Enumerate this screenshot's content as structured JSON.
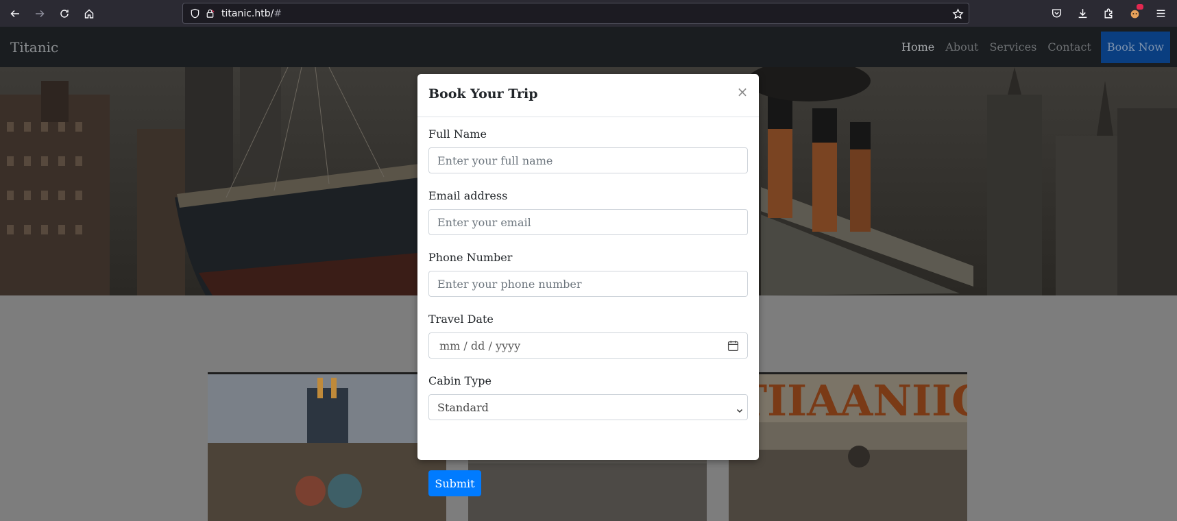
{
  "browser": {
    "url_host": "titanic.htb/",
    "url_suffix": "#",
    "icons": [
      "back-icon",
      "forward-icon",
      "reload-icon",
      "home-icon",
      "shield-icon",
      "lock-icon",
      "bookmark-star-icon",
      "pocket-icon",
      "download-icon",
      "extensions-icon",
      "profile-icon",
      "menu-icon"
    ]
  },
  "site": {
    "brand": "Titanic",
    "menu": [
      "Home",
      "About",
      "Services",
      "Contact"
    ],
    "book_now": "Book Now"
  },
  "modal": {
    "title": "Book Your Trip",
    "close": "×",
    "fields": {
      "name": {
        "label": "Full Name",
        "placeholder": "Enter your full name"
      },
      "email": {
        "label": "Email address",
        "placeholder": "Enter your email"
      },
      "phone": {
        "label": "Phone Number",
        "placeholder": "Enter your phone number"
      },
      "date": {
        "label": "Travel Date",
        "placeholder": "mm / dd / yyyy"
      },
      "cabin": {
        "label": "Cabin Type",
        "value": "Standard"
      }
    },
    "submit": "Submit"
  },
  "colors": {
    "accent": "#007bff",
    "navbar": "#1a1d20",
    "backdrop": "#7d7d7d"
  }
}
